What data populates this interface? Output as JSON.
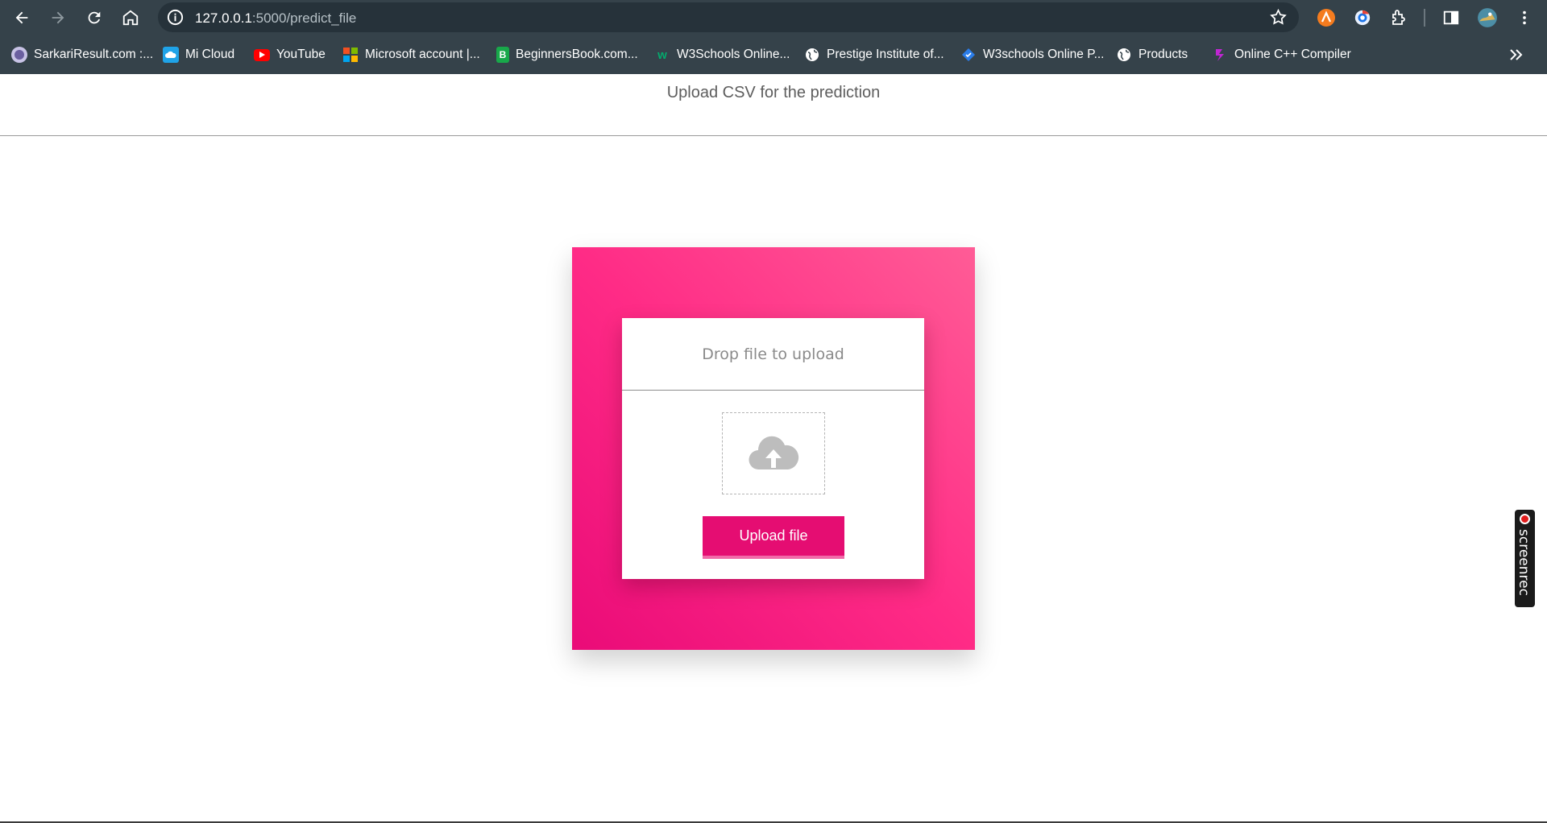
{
  "browser": {
    "url_host": "127.0.0.1",
    "url_path": ":5000/predict_file",
    "bookmarks": [
      {
        "label": "SarkariResult.com :...",
        "icon": "sarkari-icon",
        "color": "#6b5fa0"
      },
      {
        "label": "Mi Cloud",
        "icon": "mi-cloud-icon",
        "color": "#1fa3e8"
      },
      {
        "label": "YouTube",
        "icon": "youtube-icon",
        "color": "#ff0000"
      },
      {
        "label": "Microsoft account |...",
        "icon": "microsoft-icon",
        "color": "#f25022"
      },
      {
        "label": "BeginnersBook.com...",
        "icon": "beginnersbook-icon",
        "color": "#18a84a"
      },
      {
        "label": "W3Schools Online...",
        "icon": "w3schools-icon",
        "color": "#04aa6d"
      },
      {
        "label": "Prestige Institute of...",
        "icon": "globe-icon",
        "color": "#ffffff"
      },
      {
        "label": "W3schools Online P...",
        "icon": "w3schools-p-icon",
        "color": "#2b7de9"
      },
      {
        "label": "Products",
        "icon": "globe-icon",
        "color": "#ffffff"
      },
      {
        "label": "Online C++ Compiler",
        "icon": "compiler-icon",
        "color": "#c026d3"
      }
    ]
  },
  "page": {
    "title": "Upload CSV for the prediction"
  },
  "upload": {
    "heading": "Drop file to upload",
    "button_label": "Upload file",
    "accent": "#e50d72"
  },
  "widget": {
    "label": "screenrec"
  }
}
